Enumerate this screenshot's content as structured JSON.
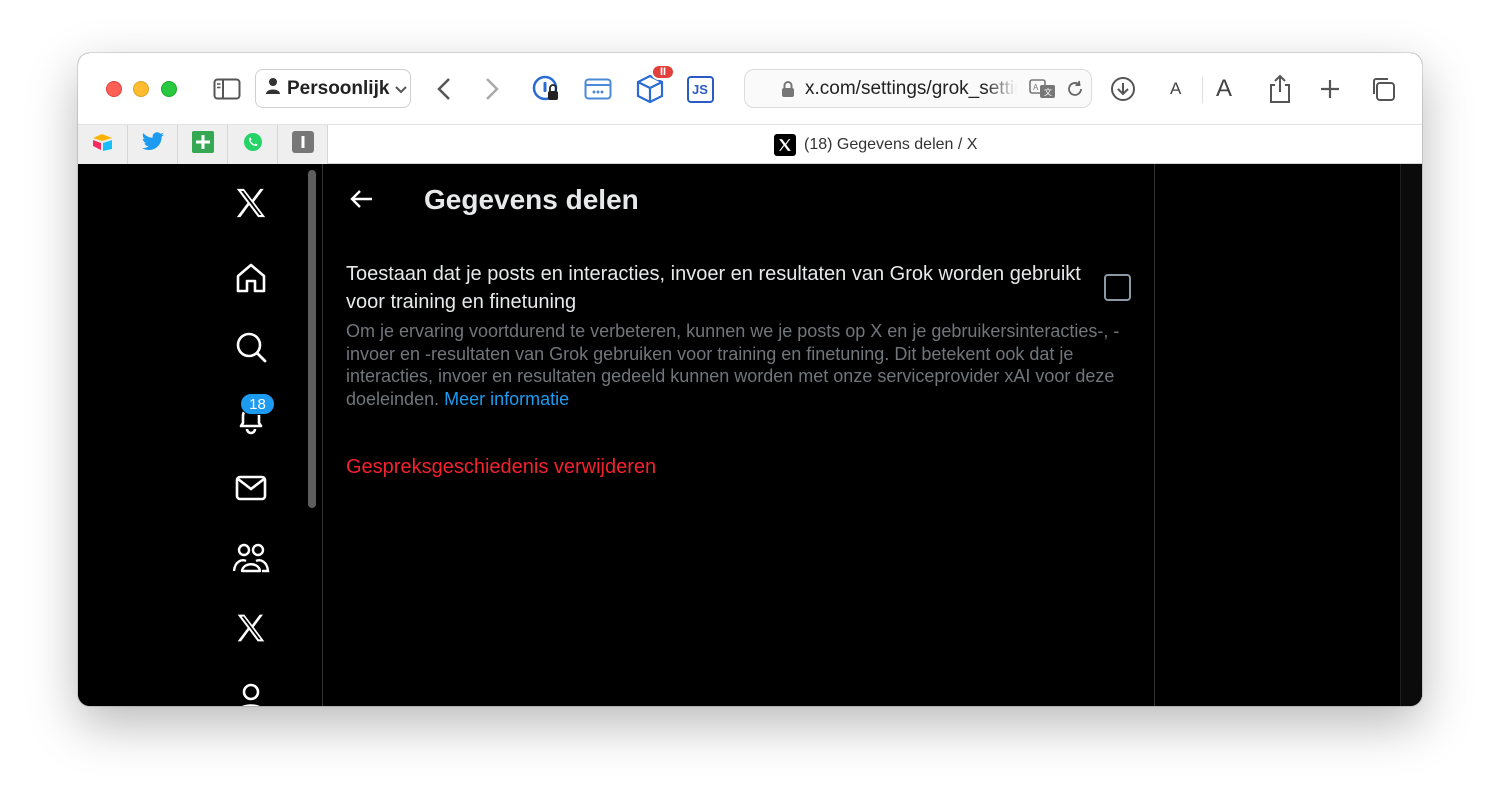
{
  "browser": {
    "profile_label": "Persoonlijk",
    "url": "x.com/settings/grok_settings",
    "extension_badge": "II",
    "js_extension_label": "JS",
    "font_small_label": "A",
    "font_large_label": "A"
  },
  "tabs": {
    "active_title": "(18) Gegevens delen / X",
    "pinned": [
      "airtable-icon",
      "twitter-icon",
      "sheets-icon",
      "whatsapp-icon",
      "instapaper-icon"
    ]
  },
  "nav": {
    "notification_count": "18",
    "items": [
      "x-logo-icon",
      "home-icon",
      "search-icon",
      "bell-icon",
      "mail-icon",
      "communities-icon",
      "x-premium-icon",
      "profile-icon"
    ]
  },
  "main": {
    "title": "Gegevens delen",
    "setting": {
      "title": "Toestaan dat je posts en interacties, invoer en resultaten van Grok worden gebruikt voor training en finetuning",
      "checked": false,
      "description": "Om je ervaring voortdurend te verbeteren, kunnen we je posts op X en je gebruikersinteracties-, -invoer en -resultaten van Grok gebruiken voor training en finetuning. Dit betekent ook dat je interacties, invoer en resultaten gedeeld kunnen worden met onze serviceprovider xAI voor deze doeleinden.",
      "learn_more": "Meer informatie"
    },
    "delete_history": "Gespreksgeschiedenis verwijderen"
  },
  "colors": {
    "accent": "#1d9bf0",
    "danger": "#f4212e",
    "text_primary": "#e7e9ea",
    "text_secondary": "#71767b"
  }
}
